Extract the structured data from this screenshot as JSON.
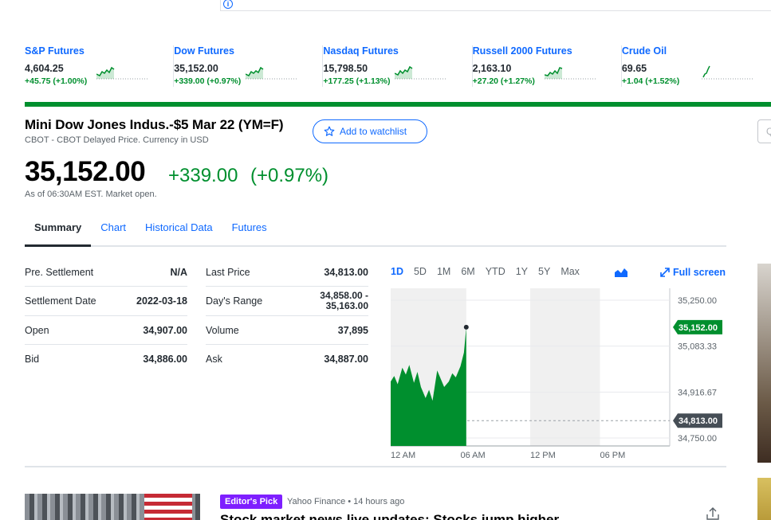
{
  "top_info": {
    "icon": "info-icon"
  },
  "ribbon": [
    {
      "name": "S&P Futures",
      "price": "4,604.25",
      "change": "+45.75 (+1.00%)"
    },
    {
      "name": "Dow Futures",
      "price": "35,152.00",
      "change": "+339.00 (+0.97%)"
    },
    {
      "name": "Nasdaq Futures",
      "price": "15,798.50",
      "change": "+177.25 (+1.13%)"
    },
    {
      "name": "Russell 2000 Futures",
      "price": "2,163.10",
      "change": "+27.20 (+1.27%)"
    },
    {
      "name": "Crude Oil",
      "price": "69.65",
      "change": "+1.04 (+1.52%)"
    }
  ],
  "quote": {
    "title": "Mini Dow Jones Indus.-$5 Mar 22 (YM=F)",
    "subtitle": "CBOT - CBOT Delayed Price. Currency in USD",
    "watchlist_label": "Add to watchlist",
    "price": "35,152.00",
    "change": "+339.00",
    "change_pct": "(+0.97%)",
    "as_of": "As of 06:30AM EST. Market open.",
    "right_box_text": "Q"
  },
  "tabs": [
    "Summary",
    "Chart",
    "Historical Data",
    "Futures"
  ],
  "summary_left": [
    {
      "label": "Pre. Settlement",
      "value": "N/A"
    },
    {
      "label": "Settlement Date",
      "value": "2022-03-18"
    },
    {
      "label": "Open",
      "value": "34,907.00"
    },
    {
      "label": "Bid",
      "value": "34,886.00"
    }
  ],
  "summary_mid": [
    {
      "label": "Last Price",
      "value": "34,813.00"
    },
    {
      "label": "Day's Range",
      "value_line1": "34,858.00 -",
      "value_line2": "35,163.00"
    },
    {
      "label": "Volume",
      "value": "37,895"
    },
    {
      "label": "Ask",
      "value": "34,887.00"
    }
  ],
  "chart_controls": {
    "ranges": [
      "1D",
      "5D",
      "1M",
      "6M",
      "YTD",
      "1Y",
      "5Y",
      "Max"
    ],
    "selected": "1D",
    "chart_type_icon": "area-chart-icon",
    "fullscreen_label": "Full screen"
  },
  "chart_data": {
    "type": "area",
    "x_tick_labels": [
      "12 AM",
      "06 AM",
      "12 PM",
      "06 PM"
    ],
    "y_tick_labels": [
      "35,250.00",
      "35,083.33",
      "34,916.67",
      "34,750.00"
    ],
    "ylim": [
      34750,
      35250
    ],
    "current_price_label": "35,152.00",
    "previous_close_label": "34,813.00",
    "previous_close": 34813,
    "color": "#008f2e",
    "x_hours": [
      0,
      0.3,
      0.6,
      1,
      1.3,
      1.6,
      2,
      2.3,
      2.6,
      3,
      3.3,
      3.6,
      4,
      4.3,
      4.6,
      5,
      5.3,
      5.6,
      6,
      6.3,
      6.5
    ],
    "values": [
      34955,
      34975,
      34945,
      35005,
      34980,
      35015,
      34950,
      34990,
      34935,
      34895,
      34925,
      34885,
      34995,
      34965,
      34935,
      34955,
      34985,
      34970,
      35010,
      35060,
      35152
    ]
  },
  "news": {
    "badge": "Editor's Pick",
    "source": "Yahoo Finance • 14 hours ago",
    "headline": "Stock market news live updates: Stocks jump higher"
  },
  "colors": {
    "accent": "#0f69ff",
    "positive": "#008f2e",
    "badge": "#7e1fff"
  }
}
